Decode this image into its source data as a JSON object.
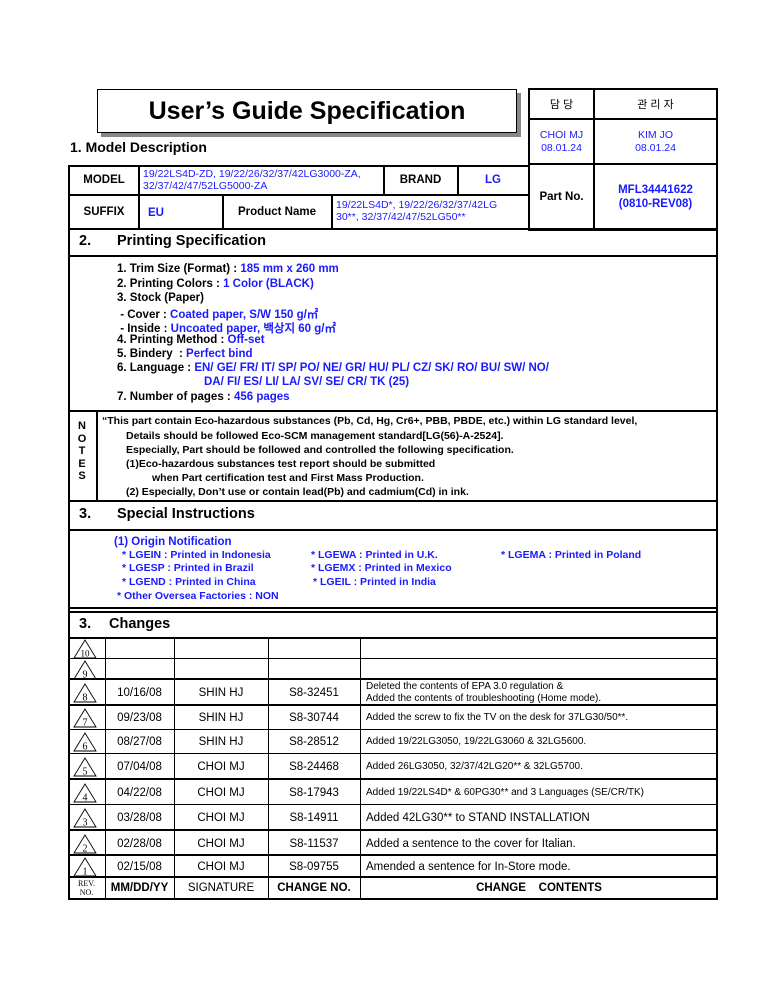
{
  "title": "User’s Guide Specification",
  "approval": {
    "headers": [
      "담 당",
      "관 리 자"
    ],
    "in_charge": {
      "name": "CHOI MJ",
      "date": "08.01.24"
    },
    "manager": {
      "name": "KIM JO",
      "date": "08.01.24"
    },
    "part_no_label": "Part No.",
    "part_no_value": "MFL34441622",
    "part_no_rev": "(0810-REV08)"
  },
  "model_description": {
    "heading": "1. Model Description",
    "model_label": "MODEL",
    "model_value_line1": "19/22LS4D-ZD, 19/22/26/32/37/42LG3000-ZA,",
    "model_value_line2": "32/37/42/47/52LG5000-ZA",
    "brand_label": "BRAND",
    "brand_value": "LG",
    "suffix_label": "SUFFIX",
    "suffix_value": "EU",
    "product_name_label": "Product Name",
    "product_name_line1": "19/22LS4D*, 19/22/26/32/37/42LG",
    "product_name_line2": "30**, 32/37/42/47/52LG50**"
  },
  "printing_spec": {
    "number": "2.",
    "heading": "Printing Specification",
    "items": [
      {
        "label": "1. Trim Size (Format) : ",
        "value": "185 mm x 260 mm"
      },
      {
        "label": "2. Printing Colors : ",
        "value": "1 Color (BLACK)"
      },
      {
        "label": "3. Stock (Paper)",
        "value": ""
      },
      {
        "label": " - Cover : ",
        "value": "Coated paper, S/W 150 g/㎡"
      },
      {
        "label": " - Inside : ",
        "value": "Uncoated paper, 백상지 60 g/㎡"
      },
      {
        "label": "4. Printing Method : ",
        "value": "Off-set"
      },
      {
        "label": "5. Bindery  : ",
        "value": "Perfect bind"
      },
      {
        "label": "6. Language : ",
        "value": "EN/ GE/ FR/ IT/ SP/ PO/ NE/ GR/ HU/ PL/ CZ/ SK/ RO/ BU/ SW/ NO/"
      },
      {
        "label": "",
        "value": "DA/ FI/ ES/ LI/ LA/ SV/ SE/ CR/ TK (25)"
      },
      {
        "label": "7. Number of pages : ",
        "value": "456 pages"
      }
    ]
  },
  "notes": {
    "label_letters": [
      "N",
      "O",
      "T",
      "E",
      "S"
    ],
    "lines": [
      "“This part contain Eco-hazardous substances (Pb, Cd, Hg, Cr6+, PBB, PBDE, etc.) within LG standard level,",
      "Details should be followed Eco-SCM management standard[LG(56)-A-2524].",
      "Especially, Part should be followed and controlled the following specification.",
      "(1)Eco-hazardous substances test report should be submitted",
      "when  Part certification test and First Mass Production.",
      "(2) Especially, Don’t use or contain lead(Pb) and cadmium(Cd) in ink."
    ]
  },
  "special_instructions": {
    "number": "3.",
    "heading": "Special Instructions",
    "origin_title": "(1) Origin Notification",
    "origins": [
      "* LGEIN : Printed in Indonesia",
      "* LGEWA : Printed in U.K.",
      "* LGEMA : Printed in Poland",
      "* LGESP : Printed in Brazil",
      "* LGEMX : Printed in Mexico",
      "* LGEND : Printed in China",
      "* LGEIL : Printed in India",
      "* Other Oversea Factories : NON"
    ]
  },
  "changes": {
    "number": "3.",
    "heading": "Changes",
    "rows": [
      {
        "rev": "10",
        "date": "",
        "signature": "",
        "change_no": "",
        "contents": ""
      },
      {
        "rev": "9",
        "date": "",
        "signature": "",
        "change_no": "",
        "contents": ""
      },
      {
        "rev": "8",
        "date": "10/16/08",
        "signature": "SHIN HJ",
        "change_no": "S8-32451",
        "contents": "Deleted the contents of EPA 3.0 regulation &",
        "contents2": "Added the contents of troubleshooting (Home mode)."
      },
      {
        "rev": "7",
        "date": "09/23/08",
        "signature": "SHIN HJ",
        "change_no": "S8-30744",
        "contents": "Added the screw to fix the TV on the desk for 37LG30/50**."
      },
      {
        "rev": "6",
        "date": "08/27/08",
        "signature": "SHIN HJ",
        "change_no": "S8-28512",
        "contents": "Added 19/22LG3050, 19/22LG3060 & 32LG5600."
      },
      {
        "rev": "5",
        "date": "07/04/08",
        "signature": "CHOI MJ",
        "change_no": "S8-24468",
        "contents": "Added 26LG3050, 32/37/42LG20** & 32LG5700."
      },
      {
        "rev": "4",
        "date": "04/22/08",
        "signature": "CHOI MJ",
        "change_no": "S8-17943",
        "contents": "Added 19/22LS4D* & 60PG30** and 3 Languages (SE/CR/TK)"
      },
      {
        "rev": "3",
        "date": "03/28/08",
        "signature": "CHOI MJ",
        "change_no": "S8-14911",
        "contents": "Added 42LG30** to STAND INSTALLATION"
      },
      {
        "rev": "2",
        "date": "02/28/08",
        "signature": "CHOI MJ",
        "change_no": "S8-11537",
        "contents": "Added a sentence to the cover for Italian."
      },
      {
        "rev": "1",
        "date": "02/15/08",
        "signature": "CHOI MJ",
        "change_no": "S8-09755",
        "contents": "Amended a sentence for In-Store mode."
      }
    ],
    "footer": {
      "rev_no": "REV. NO.",
      "rev_line1": "REV.",
      "rev_line2": "NO.",
      "date": "MM/DD/YY",
      "signature": "SIGNATURE",
      "change_no": "CHANGE NO.",
      "contents": "CHANGE    CONTENTS"
    }
  }
}
